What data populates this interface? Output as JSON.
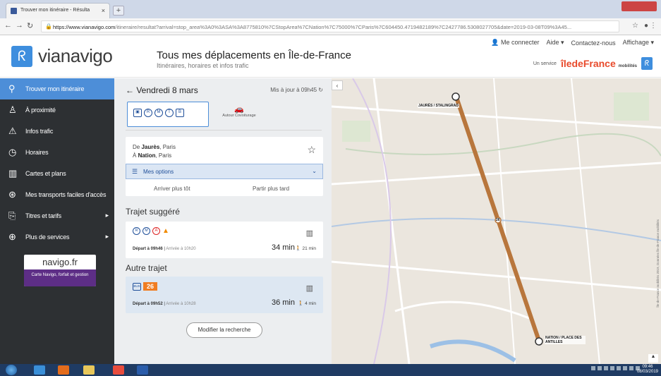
{
  "browser": {
    "tab_title": "Trouver mon itinéraire - Résulta",
    "url_domain": "https://www.vianavigo.com",
    "url_path": "/itineraire/resultat?arrival=stop_area%3A0%3ASA%3A8775810%7CStopArea%7CNation%7C75000%7CParis%7C604450.4719482189%7C2427786.5308027705&date=2019-03-08T09%3A45..."
  },
  "header": {
    "logo_text": "vianavigo",
    "title": "Tous mes déplacements en Île-de-France",
    "subtitle": "Itinéraires, horaires et infos trafic",
    "top_links": [
      "Me connecter",
      "Aide",
      "Contactez-nous",
      "Affichage"
    ],
    "service_label": "Un service",
    "service_brand_a": "îledeFrance",
    "service_brand_b": "mobilités"
  },
  "sidebar": {
    "items": [
      {
        "label": "Trouver mon itinéraire",
        "icon": "location-pin-icon"
      },
      {
        "label": "À proximité",
        "icon": "person-icon"
      },
      {
        "label": "Infos trafic",
        "icon": "warning-icon"
      },
      {
        "label": "Horaires",
        "icon": "clock-icon"
      },
      {
        "label": "Cartes et plans",
        "icon": "map-icon"
      },
      {
        "label": "Mes transports faciles d'accès",
        "icon": "accessibility-icon"
      },
      {
        "label": "Titres et tarifs",
        "icon": "ticket-icon"
      },
      {
        "label": "Plus de services",
        "icon": "plus-circle-icon"
      }
    ],
    "promo": {
      "title": "navigo.fr",
      "text": "Carte Navigo, forfait et gestion"
    }
  },
  "panel": {
    "date": "Vendredi 8 mars",
    "updated": "Mis à jour à 09h45",
    "mode_alt": "Autour Covoiturage",
    "from_prefix": "De",
    "from_name": "Jaurès",
    "from_city": ", Paris",
    "to_prefix": "À",
    "to_name": "Nation",
    "to_city": ", Paris",
    "options_label": "Mes options",
    "arrive_earlier": "Arriver plus tôt",
    "leave_later": "Partir plus tard",
    "suggested_title": "Trajet suggéré",
    "suggested": {
      "departure": "Départ à 09h46",
      "arrival": "Arrivée à 10h20",
      "duration": "34 min",
      "walk": "21 min"
    },
    "other_title": "Autre trajet",
    "other": {
      "bus_line": "26",
      "departure": "Départ à 09h52",
      "arrival": "Arrivée à 10h28",
      "duration": "36 min",
      "walk": "4 min"
    },
    "modify_label": "Modifier la recherche"
  },
  "map": {
    "start_label": "JAURÈS / STALINGRAD",
    "end_label": "NATION / PLACE DES ANTILLES",
    "line_label": "26",
    "route_color": "#b8763c",
    "credit": "Île-de-France mobilités 2019, Données Île-de-France mobilités"
  },
  "taskbar": {
    "time": "09:46",
    "date": "08/03/2019"
  }
}
